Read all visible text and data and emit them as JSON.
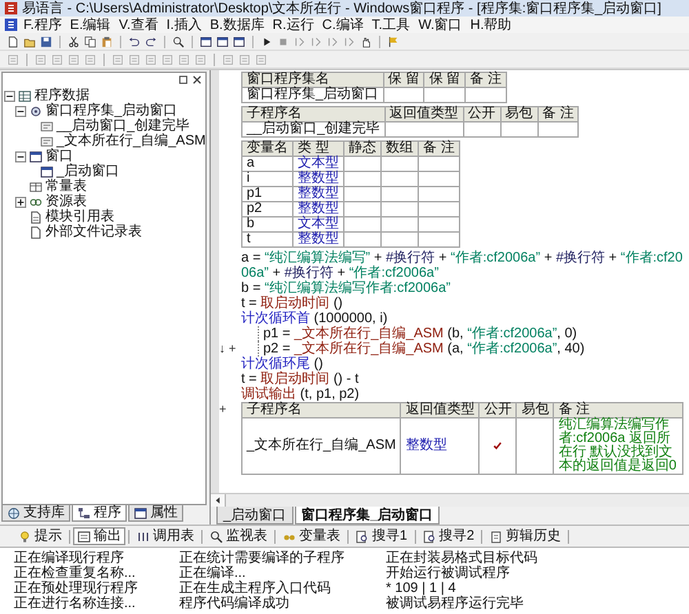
{
  "window": {
    "title": "易语言 - C:\\Users\\Administrator\\Desktop\\文本所在行 - Windows窗口程序 - [程序集:窗口程序集_启动窗口]"
  },
  "menu": [
    "F.程序",
    "E.编辑",
    "V.查看",
    "I.插入",
    "B.数据库",
    "R.运行",
    "C.编译",
    "T.工具",
    "W.窗口",
    "H.帮助"
  ],
  "tree": {
    "items": [
      {
        "label": "程序数据",
        "kind": "data",
        "expanded": true,
        "children": [
          {
            "label": "窗口程序集_启动窗口",
            "kind": "assembly",
            "expanded": true,
            "children": [
              {
                "label": "__启动窗口_创建完毕",
                "kind": "sub"
              },
              {
                "label": "_文本所在行_自编_ASM",
                "kind": "sub"
              }
            ]
          },
          {
            "label": "窗口",
            "kind": "window",
            "expanded": true,
            "children": [
              {
                "label": "_启动窗口",
                "kind": "window"
              }
            ]
          },
          {
            "label": "常量表",
            "kind": "const"
          },
          {
            "label": "资源表",
            "kind": "resource",
            "expanded": false
          },
          {
            "label": "模块引用表",
            "kind": "module"
          },
          {
            "label": "外部文件记录表",
            "kind": "file"
          }
        ]
      }
    ]
  },
  "left_tabs": [
    {
      "label": "支持库",
      "kind": "library",
      "selected": false
    },
    {
      "label": "程序",
      "kind": "program",
      "selected": true
    },
    {
      "label": "属性",
      "kind": "properties",
      "selected": false
    }
  ],
  "editor": {
    "blocks": [
      {
        "kind": "table",
        "columns": [
          "窗口程序集名",
          "保 留",
          "保 留",
          "备 注"
        ],
        "rows": [
          [
            {
              "text": "窗口程序集_启动窗口",
              "kind": "plain"
            },
            {
              "text": "",
              "kind": "plain"
            },
            {
              "text": "",
              "kind": "plain"
            },
            {
              "text": "",
              "kind": "plain"
            }
          ]
        ]
      },
      {
        "kind": "table",
        "columns": [
          "子程序名",
          "返回值类型",
          "公开",
          "易包",
          "备 注"
        ],
        "rows": [
          [
            {
              "text": "__启动窗口_创建完毕",
              "kind": "plain"
            },
            {
              "text": "",
              "kind": "plain"
            },
            {
              "text": "",
              "kind": "plain"
            },
            {
              "text": "",
              "kind": "plain"
            },
            {
              "text": "",
              "kind": "plain"
            }
          ]
        ]
      },
      {
        "kind": "table",
        "columns": [
          "变量名",
          "类 型",
          "静态",
          "数组",
          "备 注"
        ],
        "rows": [
          [
            {
              "text": "a",
              "kind": "plain"
            },
            {
              "text": "文本型",
              "kind": "type"
            },
            {
              "text": "",
              "kind": "plain"
            },
            {
              "text": "",
              "kind": "plain"
            },
            {
              "text": "",
              "kind": "plain"
            }
          ],
          [
            {
              "text": "i",
              "kind": "plain"
            },
            {
              "text": "整数型",
              "kind": "type"
            },
            {
              "text": "",
              "kind": "plain"
            },
            {
              "text": "",
              "kind": "plain"
            },
            {
              "text": "",
              "kind": "plain"
            }
          ],
          [
            {
              "text": "p1",
              "kind": "plain"
            },
            {
              "text": "整数型",
              "kind": "type"
            },
            {
              "text": "",
              "kind": "plain"
            },
            {
              "text": "",
              "kind": "plain"
            },
            {
              "text": "",
              "kind": "plain"
            }
          ],
          [
            {
              "text": "p2",
              "kind": "plain"
            },
            {
              "text": "整数型",
              "kind": "type"
            },
            {
              "text": "",
              "kind": "plain"
            },
            {
              "text": "",
              "kind": "plain"
            },
            {
              "text": "",
              "kind": "plain"
            }
          ],
          [
            {
              "text": "b",
              "kind": "plain"
            },
            {
              "text": "文本型",
              "kind": "type"
            },
            {
              "text": "",
              "kind": "plain"
            },
            {
              "text": "",
              "kind": "plain"
            },
            {
              "text": "",
              "kind": "plain"
            }
          ],
          [
            {
              "text": "t",
              "kind": "plain"
            },
            {
              "text": "整数型",
              "kind": "type"
            },
            {
              "text": "",
              "kind": "plain"
            },
            {
              "text": "",
              "kind": "plain"
            },
            {
              "text": "",
              "kind": "plain"
            }
          ]
        ]
      },
      {
        "kind": "line",
        "tokens": [
          {
            "text": "a = ",
            "kind": "plain"
          },
          {
            "text": "“纯汇编算法编写”",
            "kind": "string"
          },
          {
            "text": " + ",
            "kind": "plain"
          },
          {
            "text": "#换行符",
            "kind": "constant"
          },
          {
            "text": " + ",
            "kind": "plain"
          },
          {
            "text": "“作者:cf2006a”",
            "kind": "string"
          },
          {
            "text": " + ",
            "kind": "plain"
          },
          {
            "text": "#换行符",
            "kind": "constant"
          },
          {
            "text": " + ",
            "kind": "plain"
          },
          {
            "text": "“作者:cf2006a”",
            "kind": "string"
          },
          {
            "text": " + ",
            "kind": "plain"
          },
          {
            "text": "#换行符",
            "kind": "constant"
          },
          {
            "text": " + ",
            "kind": "plain"
          },
          {
            "text": "“作者:cf2006a”",
            "kind": "string"
          }
        ]
      },
      {
        "kind": "line",
        "tokens": [
          {
            "text": "b = ",
            "kind": "plain"
          },
          {
            "text": "“纯汇编算法编写作者:cf2006a”",
            "kind": "string"
          }
        ]
      },
      {
        "kind": "line",
        "tokens": [
          {
            "text": "t = ",
            "kind": "plain"
          },
          {
            "text": "取启动时间",
            "kind": "function"
          },
          {
            "text": " ()",
            "kind": "plain"
          }
        ]
      },
      {
        "kind": "line",
        "tokens": [
          {
            "text": "计次循环首",
            "kind": "loop"
          },
          {
            "text": " (1000000, i)",
            "kind": "plain"
          }
        ],
        "children": [
          {
            "kind": "line",
            "tokens": [
              {
                "text": "p1 = ",
                "kind": "plain"
              },
              {
                "text": "_文本所在行_自编_ASM",
                "kind": "function"
              },
              {
                "text": " (b, ",
                "kind": "plain"
              },
              {
                "text": "“作者:cf2006a”",
                "kind": "string"
              },
              {
                "text": ", 0)",
                "kind": "plain"
              }
            ]
          },
          {
            "kind": "line",
            "marker": "↓ +",
            "tokens": [
              {
                "text": "p2 = ",
                "kind": "plain"
              },
              {
                "text": "_文本所在行_自编_ASM",
                "kind": "function"
              },
              {
                "text": " (a, ",
                "kind": "plain"
              },
              {
                "text": "“作者:cf2006a”",
                "kind": "string"
              },
              {
                "text": ", 40)",
                "kind": "plain"
              }
            ]
          }
        ]
      },
      {
        "kind": "line",
        "tokens": [
          {
            "text": "计次循环尾",
            "kind": "loop"
          },
          {
            "text": " ()",
            "kind": "plain"
          }
        ]
      },
      {
        "kind": "line",
        "tokens": [
          {
            "text": "t = ",
            "kind": "plain"
          },
          {
            "text": "取启动时间",
            "kind": "function"
          },
          {
            "text": " () - t",
            "kind": "plain"
          }
        ]
      },
      {
        "kind": "line",
        "tokens": [
          {
            "text": "调试输出",
            "kind": "function"
          },
          {
            "text": " (t, p1, p2)",
            "kind": "plain"
          }
        ]
      },
      {
        "kind": "table",
        "marker": "+",
        "columns": [
          "子程序名",
          "返回值类型",
          "公开",
          "易包",
          "备 注"
        ],
        "rows": [
          [
            {
              "text": "_文本所在行_自编_ASM",
              "kind": "plain"
            },
            {
              "text": "整数型",
              "kind": "type"
            },
            {
              "kind": "check",
              "checked": true
            },
            {
              "text": "",
              "kind": "plain"
            },
            {
              "text": "纯汇编算法编写作者:cf2006a  返回所在行 默认没找到文本的返回值是返回0",
              "kind": "comment"
            }
          ]
        ]
      }
    ]
  },
  "editor_tabs": [
    {
      "label": "_启动窗口",
      "selected": false
    },
    {
      "label": "窗口程序集_启动窗口",
      "selected": true
    }
  ],
  "output_tabs": [
    {
      "label": "提示",
      "kind": "hint",
      "selected": false
    },
    {
      "label": "输出",
      "kind": "output",
      "selected": true
    },
    {
      "label": "调用表",
      "kind": "calls",
      "selected": false
    },
    {
      "label": "监视表",
      "kind": "watch",
      "selected": false
    },
    {
      "label": "变量表",
      "kind": "variables",
      "selected": false
    },
    {
      "label": "搜寻1",
      "kind": "search",
      "selected": false
    },
    {
      "label": "搜寻2",
      "kind": "search",
      "selected": false
    },
    {
      "label": "剪辑历史",
      "kind": "history",
      "selected": false
    }
  ],
  "output": {
    "lines": [
      "正在编译现行程序",
      "正在检查重复名称...",
      "正在预处理现行程序",
      "正在进行名称连接...",
      "正在统计需要编译的子程序",
      "正在编译...",
      "正在生成主程序入口代码",
      "程序代码编译成功",
      "正在封装易格式目标代码",
      "开始运行被调试程序",
      "* 109 | 1 | 4",
      "被调试易程序运行完毕"
    ]
  }
}
